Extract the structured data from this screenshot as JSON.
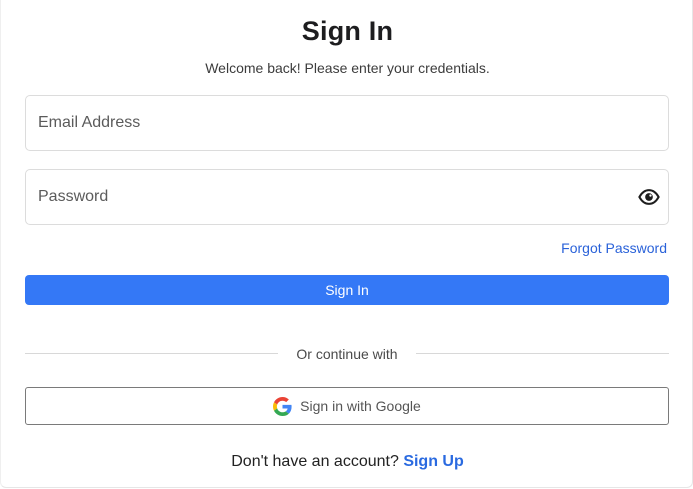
{
  "header": {
    "title": "Sign In",
    "subtitle": "Welcome back! Please enter your credentials."
  },
  "form": {
    "email": {
      "value": "",
      "placeholder": "Email Address"
    },
    "password": {
      "value": "",
      "placeholder": "Password",
      "toggle_icon": "eye-icon"
    },
    "forgot_label": "Forgot Password",
    "submit_label": "Sign In"
  },
  "divider": {
    "label": "Or continue with"
  },
  "social": {
    "google_label": "Sign in with Google",
    "google_icon": "google-logo-icon"
  },
  "footer": {
    "prompt": "Don't have an account?",
    "signup_label": "Sign Up"
  },
  "colors": {
    "primary": "#3478f6",
    "link": "#2a62d9",
    "border": "#dcdcdc"
  }
}
